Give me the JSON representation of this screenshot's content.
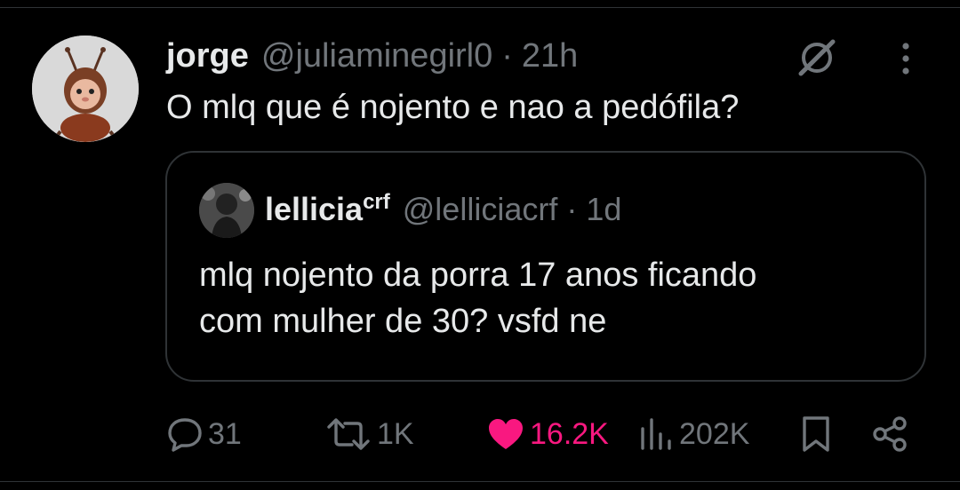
{
  "tweet": {
    "display_name": "jorge",
    "handle": "@juliaminegirl0",
    "separator": "·",
    "time": "21h",
    "text": "O mlq que é nojento e nao a pedófila?",
    "avatar_icon": "cartoon-ant-avatar",
    "grok_icon": "grok-icon",
    "more_icon": "more-vertical-icon"
  },
  "quote": {
    "display_name": "lellicia",
    "name_superscript": "crf",
    "handle": "@lelliciacrf",
    "separator": "·",
    "time": "1d",
    "text": "mlq nojento da porra 17 anos ficando\ncom mulher de 30? vsfd ne",
    "avatar_icon": "profile-photo-avatar"
  },
  "actions": {
    "replies": "31",
    "reposts": "1K",
    "likes": "16.2K",
    "views": "202K",
    "like_color": "#f91880",
    "muted_color": "#71767b"
  }
}
